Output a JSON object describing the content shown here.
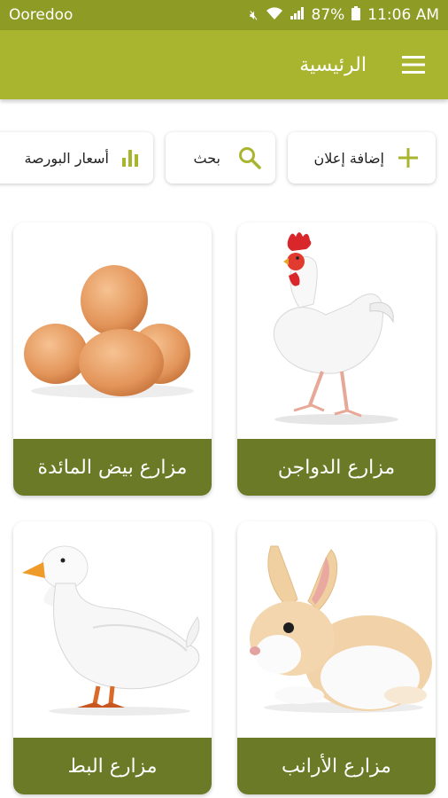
{
  "status_bar": {
    "carrier": "Ooredoo",
    "battery": "87%",
    "time": "11:06 AM"
  },
  "app_bar": {
    "title": "الرئيسية"
  },
  "actions": {
    "add_ad": "إضافة إعلان",
    "search": "بحث",
    "prices": "أسعار البورصة"
  },
  "categories": [
    {
      "label": "مزارع الدواجن",
      "image": "chicken"
    },
    {
      "label": "مزارع بيض المائدة",
      "image": "eggs"
    },
    {
      "label": "مزارع الأرانب",
      "image": "rabbit"
    },
    {
      "label": "مزارع البط",
      "image": "duck"
    }
  ],
  "colors": {
    "status_bar": "#8e9b24",
    "app_bar": "#a9b52e",
    "card_label": "#6a7a26",
    "accent": "#a9b52e"
  }
}
